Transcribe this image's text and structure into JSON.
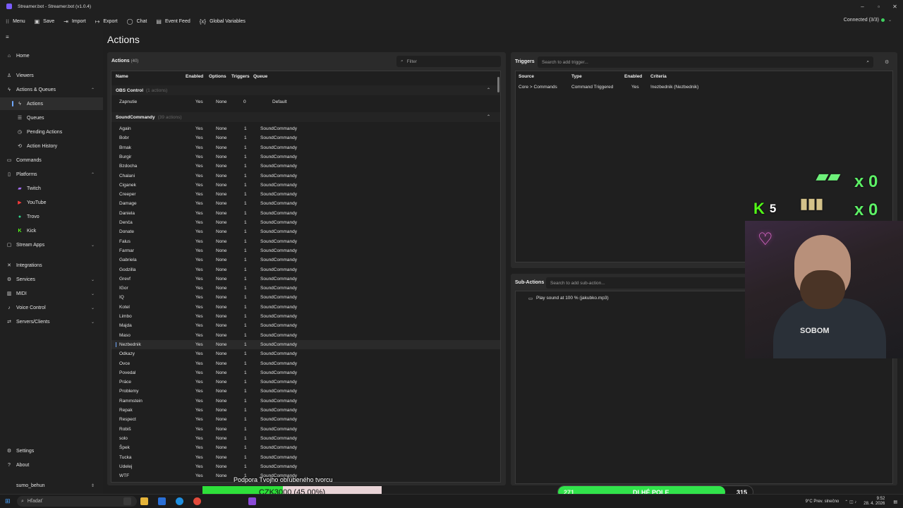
{
  "window": {
    "title": "Streamer.bot - Streamer.bot (v1.0.4)"
  },
  "toolbar": {
    "menu": "Menu",
    "save": "Save",
    "import": "Import",
    "export": "Export",
    "chat": "Chat",
    "event_feed": "Event Feed",
    "global_variables": "Global Variables",
    "connection": "Connected (3/3)"
  },
  "sidebar": {
    "items": [
      {
        "label": "Home",
        "icon": "home-icon"
      },
      {
        "label": "Viewers",
        "icon": "user-icon"
      },
      {
        "label": "Actions & Queues",
        "icon": "lightning-icon"
      },
      {
        "label": "Actions",
        "icon": "action-icon"
      },
      {
        "label": "Queues",
        "icon": "queue-icon"
      },
      {
        "label": "Pending Actions",
        "icon": "pending-icon"
      },
      {
        "label": "Action History",
        "icon": "history-icon"
      },
      {
        "label": "Commands",
        "icon": "command-icon"
      },
      {
        "label": "Platforms",
        "icon": "platforms-icon"
      },
      {
        "label": "Twitch",
        "icon": "twitch-icon"
      },
      {
        "label": "YouTube",
        "icon": "youtube-icon"
      },
      {
        "label": "Trovo",
        "icon": "trovo-icon"
      },
      {
        "label": "Kick",
        "icon": "kick-icon"
      },
      {
        "label": "Stream Apps",
        "icon": "apps-icon"
      },
      {
        "label": "Integrations",
        "icon": "integrations-icon"
      },
      {
        "label": "Services",
        "icon": "services-icon"
      },
      {
        "label": "MIDI",
        "icon": "midi-icon"
      },
      {
        "label": "Voice Control",
        "icon": "mic-icon"
      },
      {
        "label": "Servers/Clients",
        "icon": "server-icon"
      },
      {
        "label": "Settings",
        "icon": "gear-icon"
      },
      {
        "label": "About",
        "icon": "info-icon"
      },
      {
        "label": "sumo_behun",
        "icon": "profile-icon"
      }
    ]
  },
  "page": {
    "title": "Actions"
  },
  "actions": {
    "header": "Actions",
    "count": "(40)",
    "filter_placeholder": "Filter",
    "columns": [
      "Name",
      "Enabled",
      "Options",
      "Triggers",
      "Queue"
    ],
    "groups": [
      {
        "name": "OBS Control",
        "count": "(1 actions)"
      },
      {
        "name": "SoundCommandy",
        "count": "(39 actions)"
      }
    ],
    "obs_row": {
      "name": "Zapnutie",
      "enabled": "Yes",
      "options": "None",
      "triggers": "0",
      "queue": "Default"
    },
    "rows": [
      {
        "name": "Again",
        "enabled": "Yes",
        "options": "None",
        "triggers": "1",
        "queue": "SoundCommandy"
      },
      {
        "name": "Bobr",
        "enabled": "Yes",
        "options": "None",
        "triggers": "1",
        "queue": "SoundCommandy"
      },
      {
        "name": "Brnak",
        "enabled": "Yes",
        "options": "None",
        "triggers": "1",
        "queue": "SoundCommandy"
      },
      {
        "name": "Burgir",
        "enabled": "Yes",
        "options": "None",
        "triggers": "1",
        "queue": "SoundCommandy"
      },
      {
        "name": "Bzdocha",
        "enabled": "Yes",
        "options": "None",
        "triggers": "1",
        "queue": "SoundCommandy"
      },
      {
        "name": "Chalani",
        "enabled": "Yes",
        "options": "None",
        "triggers": "1",
        "queue": "SoundCommandy"
      },
      {
        "name": "Ciganek",
        "enabled": "Yes",
        "options": "None",
        "triggers": "1",
        "queue": "SoundCommandy"
      },
      {
        "name": "Creeper",
        "enabled": "Yes",
        "options": "None",
        "triggers": "1",
        "queue": "SoundCommandy"
      },
      {
        "name": "Damage",
        "enabled": "Yes",
        "options": "None",
        "triggers": "1",
        "queue": "SoundCommandy"
      },
      {
        "name": "Daniela",
        "enabled": "Yes",
        "options": "None",
        "triggers": "1",
        "queue": "SoundCommandy"
      },
      {
        "name": "Denča",
        "enabled": "Yes",
        "options": "None",
        "triggers": "1",
        "queue": "SoundCommandy"
      },
      {
        "name": "Donate",
        "enabled": "Yes",
        "options": "None",
        "triggers": "1",
        "queue": "SoundCommandy"
      },
      {
        "name": "Falus",
        "enabled": "Yes",
        "options": "None",
        "triggers": "1",
        "queue": "SoundCommandy"
      },
      {
        "name": "Farmar",
        "enabled": "Yes",
        "options": "None",
        "triggers": "1",
        "queue": "SoundCommandy"
      },
      {
        "name": "Gabriela",
        "enabled": "Yes",
        "options": "None",
        "triggers": "1",
        "queue": "SoundCommandy"
      },
      {
        "name": "Godzilla",
        "enabled": "Yes",
        "options": "None",
        "triggers": "1",
        "queue": "SoundCommandy"
      },
      {
        "name": "Grevf",
        "enabled": "Yes",
        "options": "None",
        "triggers": "1",
        "queue": "SoundCommandy"
      },
      {
        "name": "IGor",
        "enabled": "Yes",
        "options": "None",
        "triggers": "1",
        "queue": "SoundCommandy"
      },
      {
        "name": "IQ",
        "enabled": "Yes",
        "options": "None",
        "triggers": "1",
        "queue": "SoundCommandy"
      },
      {
        "name": "Kotel",
        "enabled": "Yes",
        "options": "None",
        "triggers": "1",
        "queue": "SoundCommandy"
      },
      {
        "name": "Limbo",
        "enabled": "Yes",
        "options": "None",
        "triggers": "1",
        "queue": "SoundCommandy"
      },
      {
        "name": "Majda",
        "enabled": "Yes",
        "options": "None",
        "triggers": "1",
        "queue": "SoundCommandy"
      },
      {
        "name": "Maso",
        "enabled": "Yes",
        "options": "None",
        "triggers": "1",
        "queue": "SoundCommandy"
      },
      {
        "name": "Nezbednik",
        "enabled": "Yes",
        "options": "None",
        "triggers": "1",
        "queue": "SoundCommandy"
      },
      {
        "name": "Odkazy",
        "enabled": "Yes",
        "options": "None",
        "triggers": "1",
        "queue": "SoundCommandy"
      },
      {
        "name": "Ovce",
        "enabled": "Yes",
        "options": "None",
        "triggers": "1",
        "queue": "SoundCommandy"
      },
      {
        "name": "Povedal",
        "enabled": "Yes",
        "options": "None",
        "triggers": "1",
        "queue": "SoundCommandy"
      },
      {
        "name": "Práce",
        "enabled": "Yes",
        "options": "None",
        "triggers": "1",
        "queue": "SoundCommandy"
      },
      {
        "name": "Problemy",
        "enabled": "Yes",
        "options": "None",
        "triggers": "1",
        "queue": "SoundCommandy"
      },
      {
        "name": "Rammstein",
        "enabled": "Yes",
        "options": "None",
        "triggers": "1",
        "queue": "SoundCommandy"
      },
      {
        "name": "Repak",
        "enabled": "Yes",
        "options": "None",
        "triggers": "1",
        "queue": "SoundCommandy"
      },
      {
        "name": "Respect",
        "enabled": "Yes",
        "options": "None",
        "triggers": "1",
        "queue": "SoundCommandy"
      },
      {
        "name": "Robiš",
        "enabled": "Yes",
        "options": "None",
        "triggers": "1",
        "queue": "SoundCommandy"
      },
      {
        "name": "solo",
        "enabled": "Yes",
        "options": "None",
        "triggers": "1",
        "queue": "SoundCommandy"
      },
      {
        "name": "Špek",
        "enabled": "Yes",
        "options": "None",
        "triggers": "1",
        "queue": "SoundCommandy"
      },
      {
        "name": "Tucka",
        "enabled": "Yes",
        "options": "None",
        "triggers": "1",
        "queue": "SoundCommandy"
      },
      {
        "name": "Udelej",
        "enabled": "Yes",
        "options": "None",
        "triggers": "1",
        "queue": "SoundCommandy"
      },
      {
        "name": "WTF",
        "enabled": "Yes",
        "options": "None",
        "triggers": "1",
        "queue": "SoundCommandy"
      }
    ],
    "selected": "Nezbednik"
  },
  "triggers": {
    "header": "Triggers",
    "search_placeholder": "Search to add trigger...",
    "columns": [
      "Source",
      "Type",
      "Enabled",
      "Criteria"
    ],
    "rows": [
      {
        "source": "Core > Commands",
        "type": "Command Triggered",
        "enabled": "Yes",
        "criteria": "!nezbednik (Nezbednik)"
      }
    ]
  },
  "subactions": {
    "header": "Sub-Actions",
    "search_placeholder": "Search to add sub-action...",
    "items": [
      "Play sound at 100 % (jakubko.mp3)"
    ]
  },
  "overlay": {
    "support_title": "Podpora Tvojho obľúbeného tvorcu",
    "support_amount": "CZK3000 (45.00%)",
    "support_progress": 0.45,
    "field_left": "271",
    "field_label": "DLHÉ POLE",
    "field_right": "315",
    "field_progress": 0.86,
    "kick_count": "5",
    "counter_top": "x 0",
    "counter_bottom": "x 0",
    "neon_heart": "♡",
    "shirt_text": "SOBOM"
  },
  "taskbar": {
    "search": "Hľadať",
    "weather": "9°C  Prev. slnečno",
    "time": "9:52",
    "date": "28. 4. 2026"
  },
  "colors": {
    "accent": "#6fa8ff",
    "connected": "#3fcf5f",
    "progress": "#2ee03a"
  }
}
